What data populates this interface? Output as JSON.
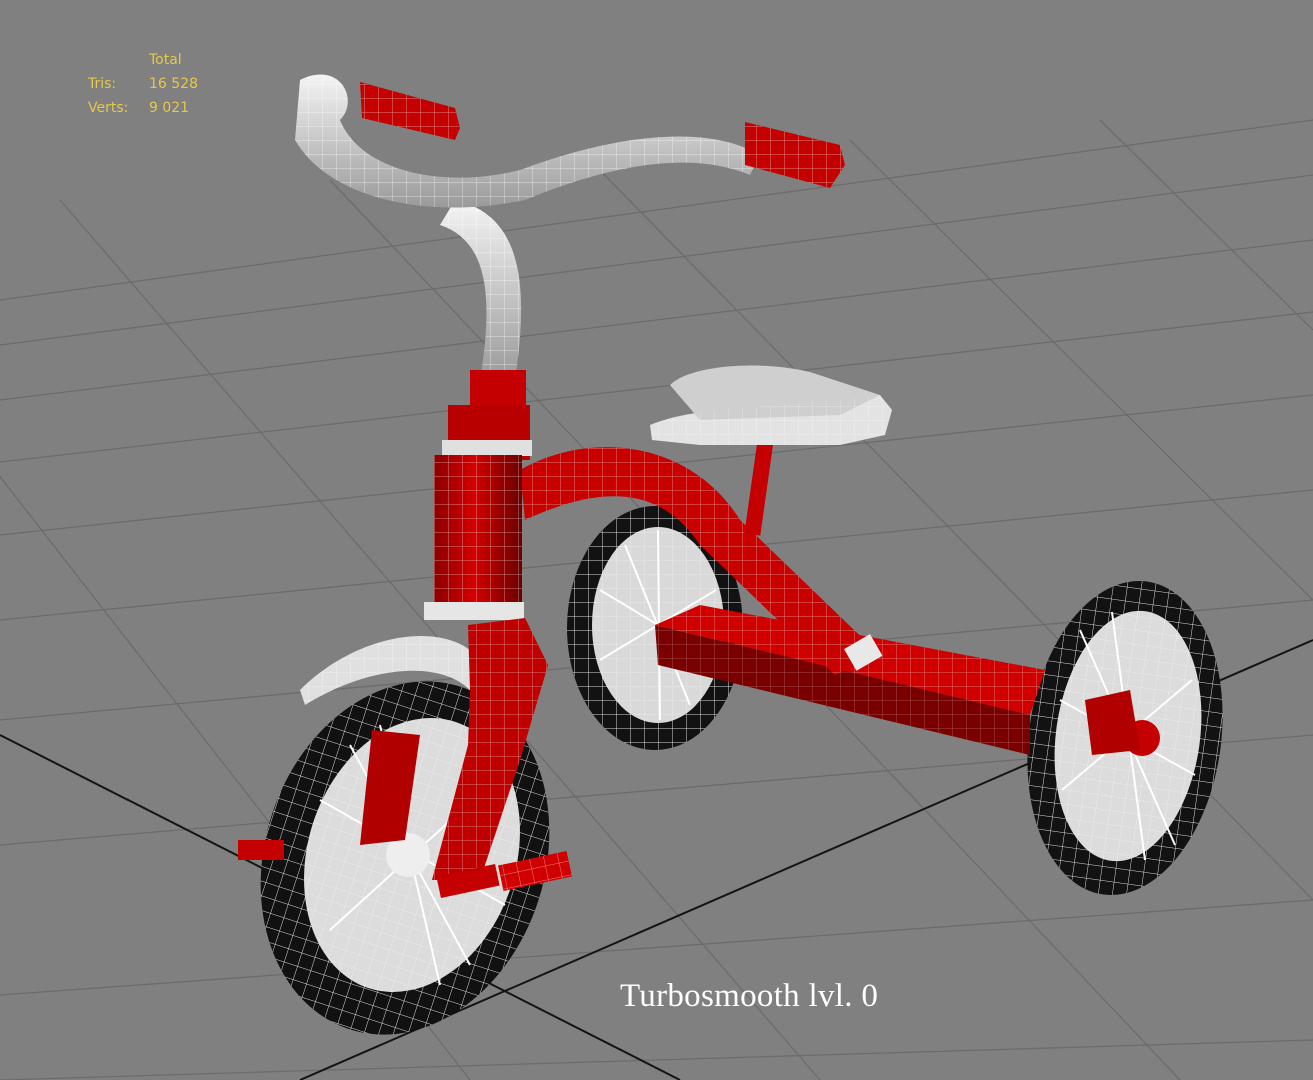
{
  "viewport": {
    "stats": {
      "header": "Total",
      "rows": [
        {
          "label": "Tris:",
          "value": "16 528"
        },
        {
          "label": "Verts:",
          "value": "9 021"
        }
      ]
    },
    "caption": "Turbosmooth lvl. 0",
    "colors": {
      "background": "#808080",
      "grid_line": "#6e6e6e",
      "grid_axis": "#111111",
      "frame_red": "#c40000",
      "frame_red_dark": "#7a0000",
      "chrome_white": "#e8e8e8",
      "tire_black": "#111111",
      "wire_white": "#ffffff",
      "stats_text": "#e6c84a"
    }
  }
}
